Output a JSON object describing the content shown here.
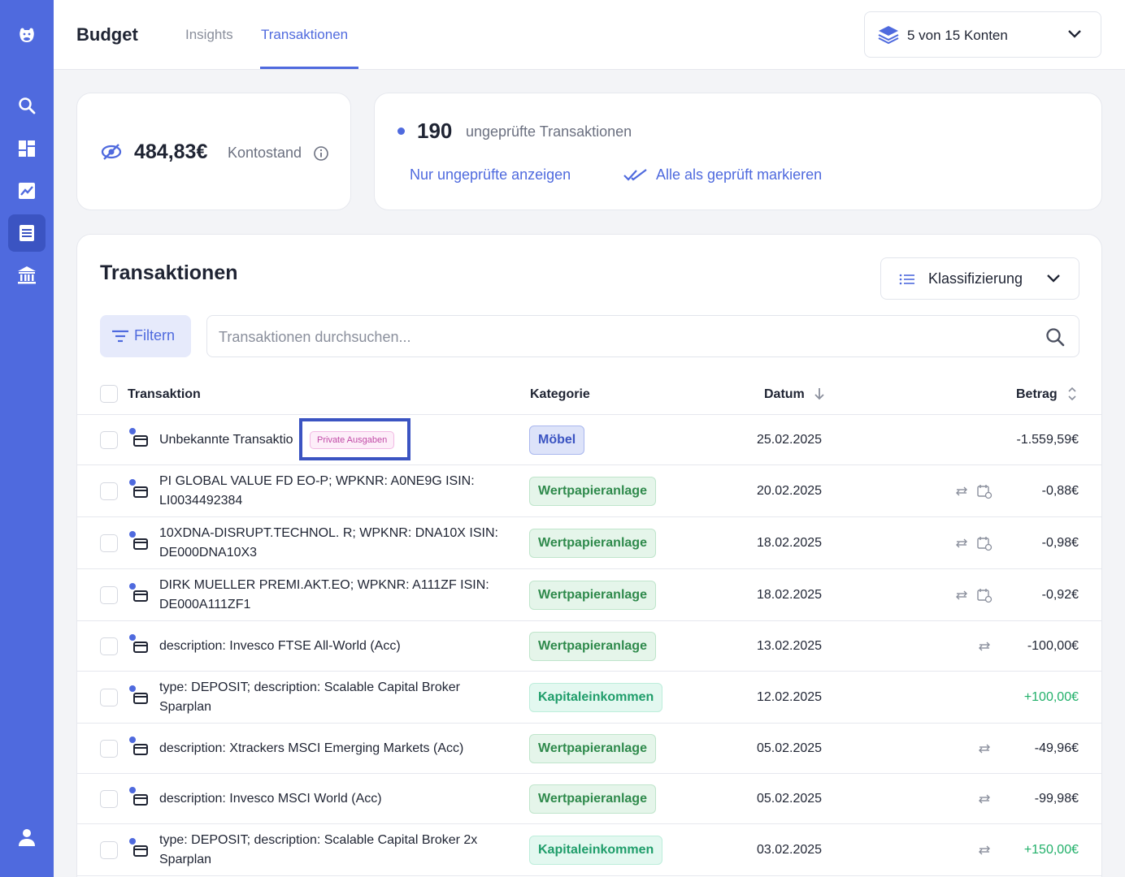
{
  "sidebar": {
    "items": [
      {
        "name": "logo",
        "icon": "hippo-logo-icon"
      },
      {
        "name": "search",
        "icon": "search-icon"
      },
      {
        "name": "dashboard",
        "icon": "dashboard-icon"
      },
      {
        "name": "chart",
        "icon": "chart-icon"
      },
      {
        "name": "transactions",
        "icon": "list-icon",
        "active": true
      },
      {
        "name": "bank",
        "icon": "bank-icon"
      },
      {
        "name": "profile",
        "icon": "user-icon"
      }
    ]
  },
  "header": {
    "title": "Budget",
    "tabs": [
      {
        "label": "Insights",
        "active": false
      },
      {
        "label": "Transaktionen",
        "active": true
      }
    ],
    "accounts_label": "5 von 15 Konten"
  },
  "balance": {
    "amount": "484,83€",
    "label": "Kontostand"
  },
  "review": {
    "count": "190",
    "count_label": "ungeprüfte Transaktionen",
    "show_unchecked": "Nur ungeprüfte anzeigen",
    "mark_all": "Alle als geprüft markieren"
  },
  "transactions": {
    "title": "Transaktionen",
    "classification_label": "Klassifizierung",
    "filter_label": "Filtern",
    "search_placeholder": "Transaktionen durchsuchen...",
    "columns": {
      "transaction": "Transaktion",
      "category": "Kategorie",
      "date": "Datum",
      "amount": "Betrag"
    },
    "rows": [
      {
        "desc1": "Unbekannte Transaktio",
        "desc2": "",
        "badge": "Private Ausgaben",
        "category": "Möbel",
        "cat_style": "blue",
        "date": "25.02.2025",
        "amount": "-1.559,59€",
        "positive": false,
        "icons": []
      },
      {
        "desc1": "PI GLOBAL VALUE FD EO-P; WPKNR: A0NE9G ISIN:",
        "desc2": "LI0034492384",
        "category": "Wertpapieranlage",
        "cat_style": "green",
        "date": "20.02.2025",
        "amount": "-0,88€",
        "positive": false,
        "icons": [
          "transfer-icon",
          "calendar-repeat-icon"
        ]
      },
      {
        "desc1": "10XDNA-DISRUPT.TECHNOL. R; WPKNR: DNA10X ISIN:",
        "desc2": "DE000DNA10X3",
        "category": "Wertpapieranlage",
        "cat_style": "green",
        "date": "18.02.2025",
        "amount": "-0,98€",
        "positive": false,
        "icons": [
          "transfer-icon",
          "calendar-repeat-icon"
        ]
      },
      {
        "desc1": "DIRK MUELLER PREMI.AKT.EO; WPKNR: A111ZF ISIN:",
        "desc2": "DE000A111ZF1",
        "category": "Wertpapieranlage",
        "cat_style": "green",
        "date": "18.02.2025",
        "amount": "-0,92€",
        "positive": false,
        "icons": [
          "transfer-icon",
          "calendar-repeat-icon"
        ]
      },
      {
        "desc1": "description: Invesco FTSE All-World (Acc)",
        "desc2": "",
        "category": "Wertpapieranlage",
        "cat_style": "green",
        "date": "13.02.2025",
        "amount": "-100,00€",
        "positive": false,
        "icons": [
          "transfer-icon"
        ]
      },
      {
        "desc1": "type: DEPOSIT; description: Scalable Capital Broker",
        "desc2": "Sparplan",
        "category": "Kapitaleinkommen",
        "cat_style": "mint",
        "date": "12.02.2025",
        "amount": "+100,00€",
        "positive": true,
        "icons": []
      },
      {
        "desc1": "description: Xtrackers MSCI Emerging Markets (Acc)",
        "desc2": "",
        "category": "Wertpapieranlage",
        "cat_style": "green",
        "date": "05.02.2025",
        "amount": "-49,96€",
        "positive": false,
        "icons": [
          "transfer-icon"
        ]
      },
      {
        "desc1": "description: Invesco MSCI World (Acc)",
        "desc2": "",
        "category": "Wertpapieranlage",
        "cat_style": "green",
        "date": "05.02.2025",
        "amount": "-99,98€",
        "positive": false,
        "icons": [
          "transfer-icon"
        ]
      },
      {
        "desc1": "type: DEPOSIT; description: Scalable Capital Broker 2x",
        "desc2": "Sparplan",
        "category": "Kapitaleinkommen",
        "cat_style": "mint",
        "date": "03.02.2025",
        "amount": "+150,00€",
        "positive": true,
        "icons": [
          "transfer-icon"
        ]
      }
    ]
  },
  "colors": {
    "accent": "#4f6ade",
    "sidebar": "#4f6ade",
    "positive": "#22b06a"
  }
}
